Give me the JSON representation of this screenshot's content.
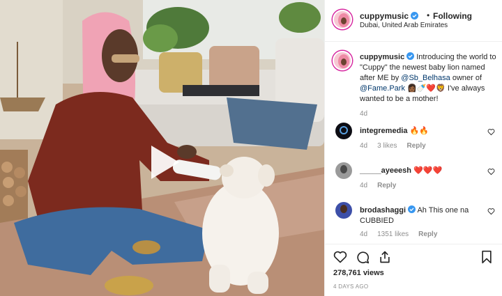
{
  "post": {
    "username": "cuppymusic",
    "following_label": "Following",
    "location": "Dubai, United Arab Emirates",
    "caption": {
      "part1": "Introducing the world to \"Cuppy\" the newest baby lion named after ME by ",
      "mention1": "@Sb_Belhasa",
      "part2": " owner of ",
      "mention2": "@Fame.Park",
      "emojis": "👩🏾🍼❤️🦁",
      "part3": " I've always wanted to be a mother!"
    },
    "caption_age": "4d",
    "views": "278,761 views",
    "time_ago": "4 DAYS AGO"
  },
  "comments": [
    {
      "username": "integremedia",
      "text": "🔥🔥",
      "age": "4d",
      "likes": "3 likes",
      "reply": "Reply"
    },
    {
      "username": "_____ayeeesh",
      "text": "❤️❤️❤️",
      "age": "4d",
      "likes": "",
      "reply": "Reply"
    },
    {
      "username": "brodashaggi",
      "text": "Ah This one na CUBBIED",
      "age": "4d",
      "likes": "1351 likes",
      "reply": "Reply"
    }
  ],
  "icons": {
    "play": "play-icon",
    "verified": "verified-badge-icon",
    "like": "heart-icon",
    "comment": "comment-icon",
    "share": "share-icon",
    "save": "bookmark-icon"
  },
  "colors": {
    "verified_blue": "#3897f0",
    "mention_blue": "#00376b",
    "muted_text": "#8e8e8e",
    "story_ring": "#d6249f"
  }
}
